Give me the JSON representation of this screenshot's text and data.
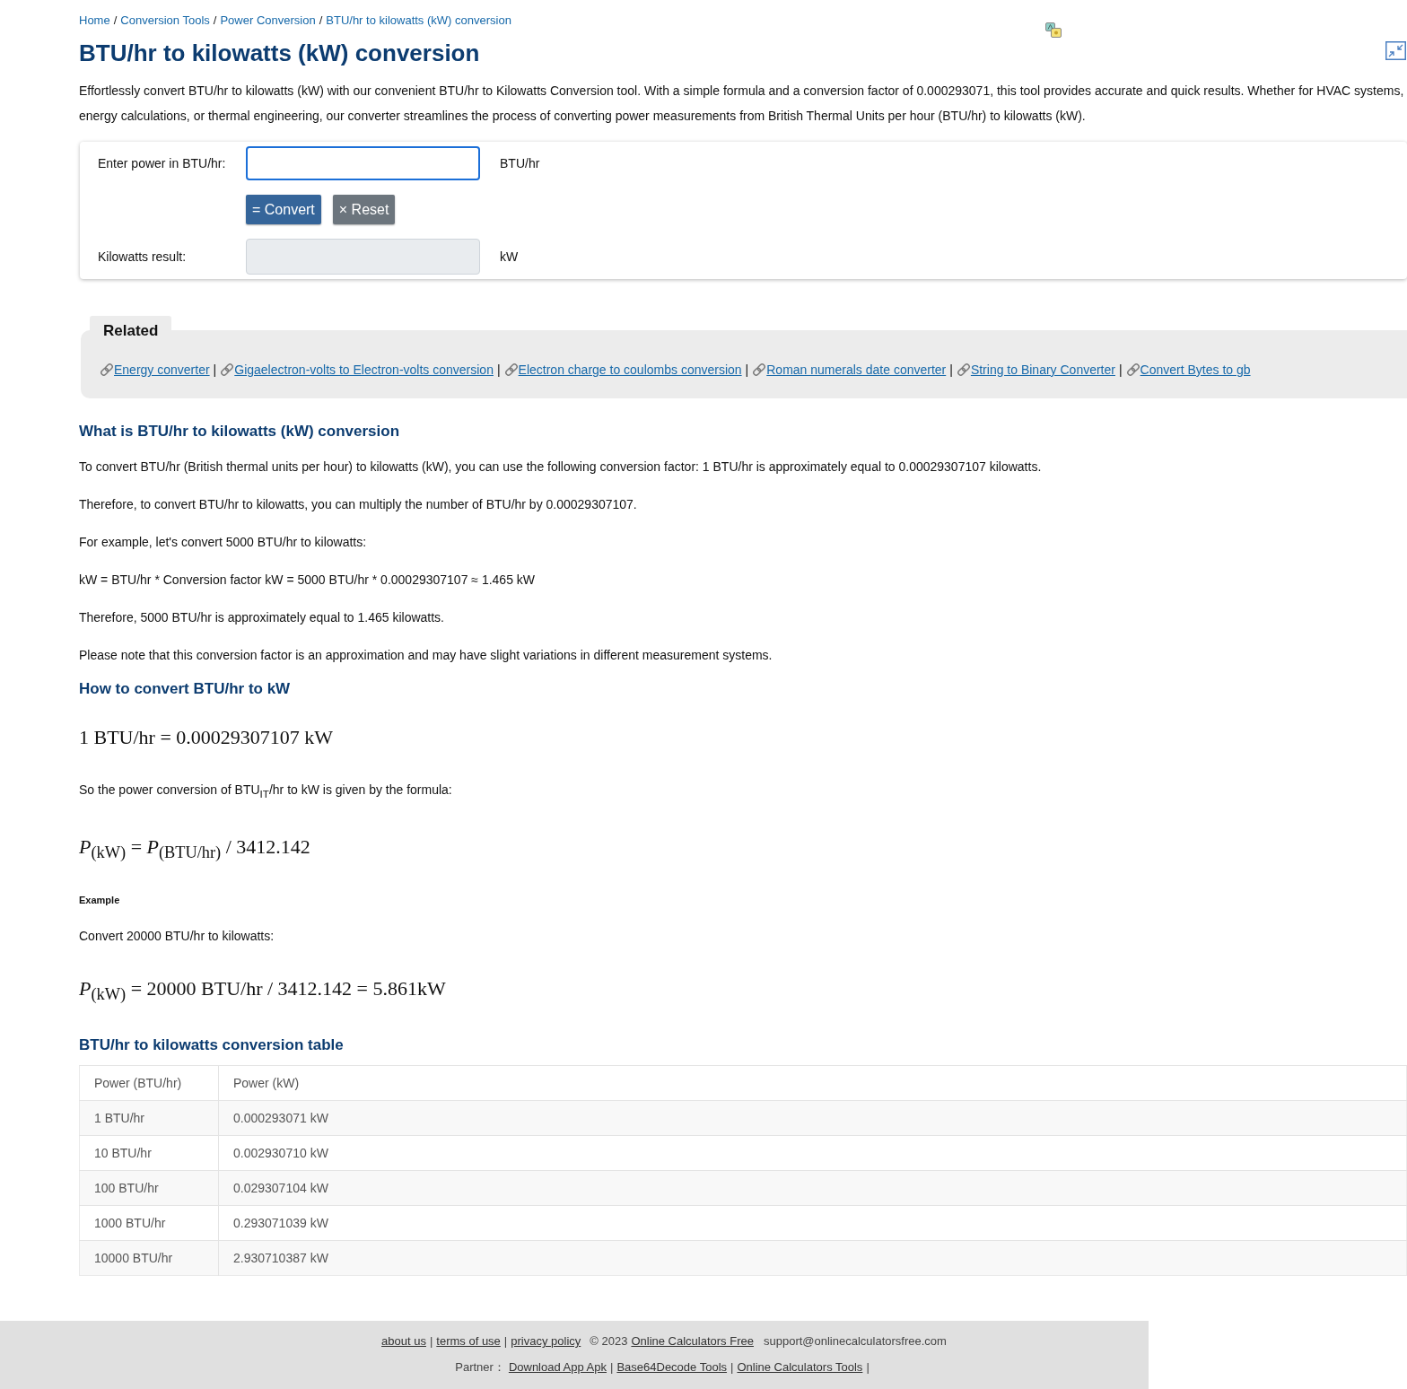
{
  "breadcrumb": {
    "separator": "/",
    "items": [
      {
        "label": "Home"
      },
      {
        "label": "Conversion Tools"
      },
      {
        "label": "Power Conversion"
      },
      {
        "label": "BTU/hr to kilowatts (kW) conversion"
      }
    ]
  },
  "title": "BTU/hr to kilowatts (kW) conversion",
  "intro": "Effortlessly convert BTU/hr to kilowatts (kW) with our convenient BTU/hr to Kilowatts Conversion tool. With a simple formula and a conversion factor of 0.000293071, this tool provides accurate and quick results. Whether for HVAC systems, energy calculations, or thermal engineering, our converter streamlines the process of converting power measurements from British Thermal Units per hour (BTU/hr) to kilowatts (kW).",
  "converter": {
    "input": {
      "label": "Enter power in BTU/hr:",
      "unit": "BTU/hr",
      "focused": true
    },
    "buttons": [
      {
        "kind": "convert",
        "label": "= Convert"
      },
      {
        "kind": "reset",
        "label": "× Reset"
      }
    ],
    "result": {
      "label": "Kilowatts result:",
      "unit": "kW",
      "disabled": true
    }
  },
  "related": {
    "title": "Related",
    "separator": "|",
    "links": [
      "Energy converter",
      "Gigaelectron-volts to Electron-volts conversion",
      "Electron charge to coulombs conversion",
      "Roman numerals date converter",
      "String to Binary Converter",
      "Convert Bytes to gb"
    ]
  },
  "sections": [
    {
      "heading": "What is BTU/hr to kilowatts (kW) conversion",
      "blocks": [
        {
          "kind": "paragraph",
          "text": "To convert BTU/hr (British thermal units per hour) to kilowatts (kW), you can use the following conversion factor: 1 BTU/hr is approximately equal to 0.00029307107 kilowatts."
        },
        {
          "kind": "paragraph",
          "text": "Therefore, to convert BTU/hr to kilowatts, you can multiply the number of BTU/hr by 0.00029307107."
        },
        {
          "kind": "paragraph",
          "text": "For example, let's convert 5000 BTU/hr to kilowatts:"
        },
        {
          "kind": "paragraph",
          "text": "kW = BTU/hr * Conversion factor kW = 5000 BTU/hr * 0.00029307107 ≈ 1.465 kW"
        },
        {
          "kind": "paragraph",
          "text": "Therefore, 5000 BTU/hr is approximately equal to 1.465 kilowatts."
        },
        {
          "kind": "paragraph",
          "text": "Please note that this conversion factor is an approximation and may have slight variations in different measurement systems."
        }
      ]
    },
    {
      "heading": "How to convert BTU/hr to kW",
      "blocks": [
        {
          "kind": "formula",
          "text": "1 BTU/hr = 0.00029307107 kW"
        },
        {
          "kind": "rich_paragraph",
          "text": "So the power conversion of BTU$_{IT}$/hr to kW is given by the formula:"
        },
        {
          "kind": "formula",
          "text": "*P*$_{(kW)}$ = *P*$_{(BTU/hr)}$ / 3412.142"
        },
        {
          "kind": "caption",
          "text": "Example"
        },
        {
          "kind": "paragraph",
          "text": "Convert 20000 BTU/hr to kilowatts:"
        },
        {
          "kind": "formula",
          "text": "*P*$_{(kW)}$ = 20000 BTU/hr / 3412.142 = 5.861kW"
        }
      ]
    }
  ],
  "table": {
    "heading": "BTU/hr to kilowatts conversion table",
    "columns": [
      "Power (BTU/hr)",
      "Power (kW)"
    ],
    "rows": [
      [
        "1 BTU/hr",
        "0.000293071 kW"
      ],
      [
        "10 BTU/hr",
        "0.002930710 kW"
      ],
      [
        "100 BTU/hr",
        "0.029307104 kW"
      ],
      [
        "1000 BTU/hr",
        "0.293071039 kW"
      ],
      [
        "10000 BTU/hr",
        "2.930710387 kW"
      ]
    ]
  },
  "footer": {
    "separator": "|",
    "links": [
      "about us",
      "terms of use",
      "privacy policy"
    ],
    "copyright": "© 2023",
    "site_link": "Online Calculators Free",
    "email": "support@onlinecalculatorsfree.com",
    "partner": {
      "label": "Partner：",
      "links": [
        "Download App Apk",
        "Base64Decode Tools",
        "Online Calculators Tools"
      ],
      "trailing_separator": true
    }
  }
}
